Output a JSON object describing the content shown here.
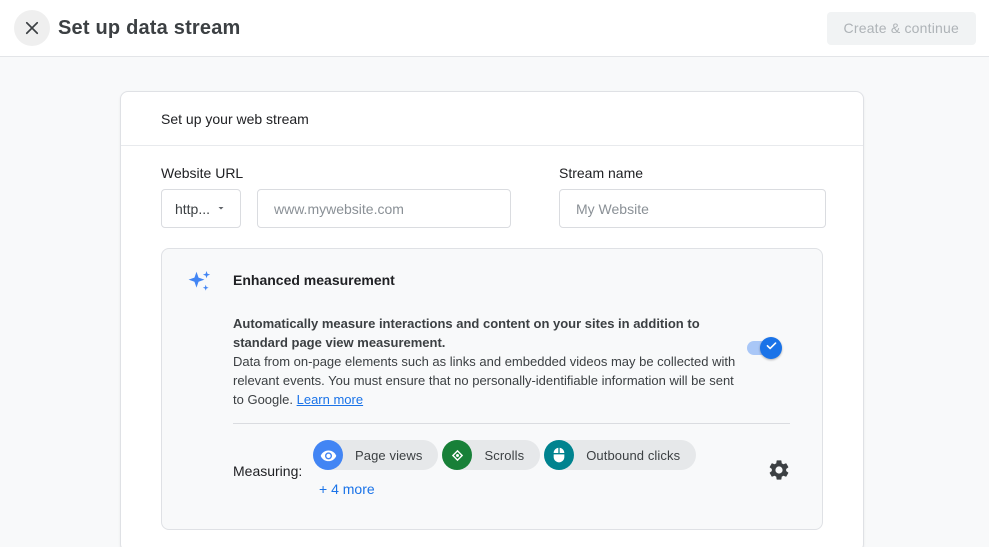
{
  "header": {
    "title": "Set up data stream",
    "create_button_label": "Create & continue"
  },
  "card": {
    "title": "Set up your web stream",
    "website_url": {
      "label": "Website URL",
      "protocol_value": "http...",
      "placeholder": "www.mywebsite.com"
    },
    "stream_name": {
      "label": "Stream name",
      "placeholder": "My Website"
    }
  },
  "enhanced_measurement": {
    "title": "Enhanced measurement",
    "description_bold": "Automatically measure interactions and content on your sites in addition to standard page view measurement.",
    "description_body": "Data from on-page elements such as links and embedded videos may be collected with relevant events. You must ensure that no personally-identifiable information will be sent to Google. ",
    "learn_more_label": "Learn more",
    "toggle_state": "on",
    "measuring_label": "Measuring:",
    "chips": [
      {
        "label": "Page views",
        "icon": "eye-icon",
        "color": "#4285f4"
      },
      {
        "label": "Scrolls",
        "icon": "scroll-icon",
        "color": "#188038"
      },
      {
        "label": "Outbound clicks",
        "icon": "mouse-icon",
        "color": "#00838f"
      }
    ],
    "more_link_label": "+ 4 more"
  },
  "icons": {
    "close": "close-icon",
    "dropdown": "chevron-down-icon",
    "sparkle": "sparkle-icon",
    "check": "check-icon",
    "settings": "gear-icon"
  },
  "colors": {
    "accent_blue": "#1a73e8",
    "toggle_track": "#a9c7f7",
    "chip_background": "#e6e8ea",
    "panel_background": "#f8f9fa",
    "disabled_button_bg": "#f1f3f4",
    "disabled_button_text": "#aeb3b7"
  }
}
